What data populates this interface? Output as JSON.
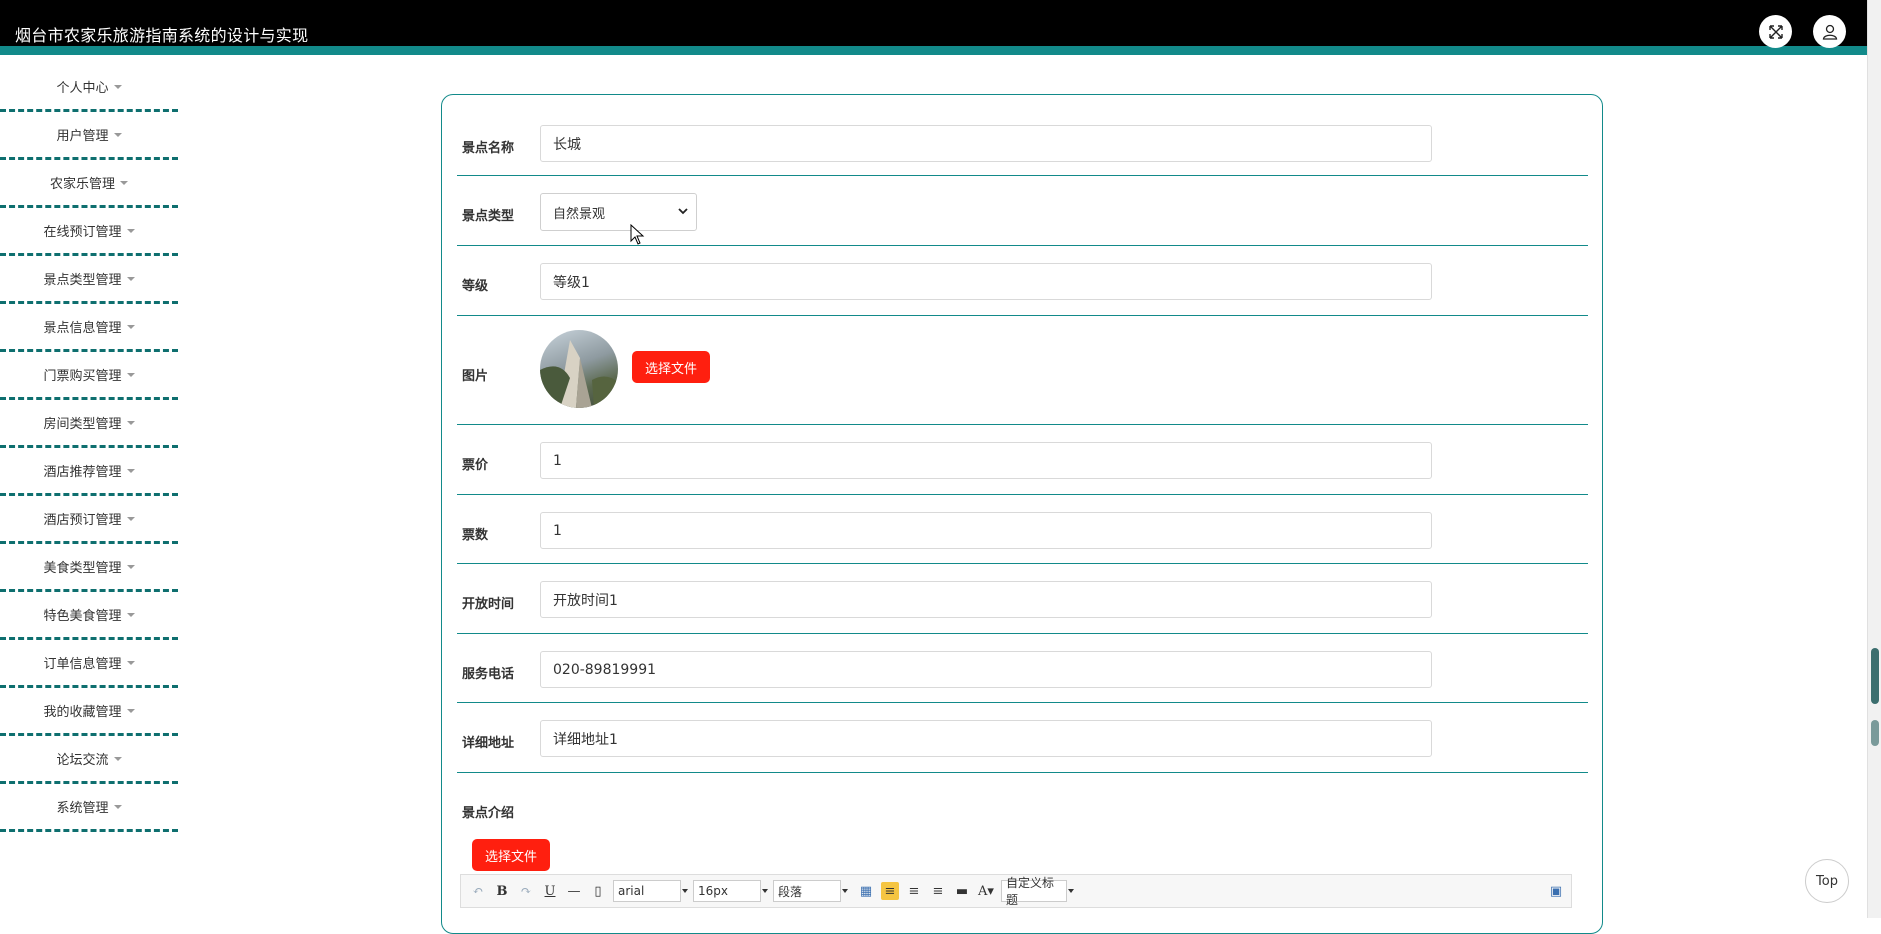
{
  "header": {
    "title": "烟台市农家乐旅游指南系统的设计与实现"
  },
  "sidebar": {
    "items": [
      {
        "label": "个人中心"
      },
      {
        "label": "用户管理"
      },
      {
        "label": "农家乐管理"
      },
      {
        "label": "在线预订管理"
      },
      {
        "label": "景点类型管理"
      },
      {
        "label": "景点信息管理"
      },
      {
        "label": "门票购买管理"
      },
      {
        "label": "房间类型管理"
      },
      {
        "label": "酒店推荐管理"
      },
      {
        "label": "酒店预订管理"
      },
      {
        "label": "美食类型管理"
      },
      {
        "label": "特色美食管理"
      },
      {
        "label": "订单信息管理"
      },
      {
        "label": "我的收藏管理"
      },
      {
        "label": "论坛交流"
      },
      {
        "label": "系统管理"
      }
    ]
  },
  "form": {
    "name_label": "景点名称",
    "name_value": "长城",
    "type_label": "景点类型",
    "type_value": "自然景观",
    "grade_label": "等级",
    "grade_value": "等级1",
    "image_label": "图片",
    "choose_file": "选择文件",
    "price_label": "票价",
    "price_value": "1",
    "count_label": "票数",
    "count_value": "1",
    "open_label": "开放时间",
    "open_value": "开放时间1",
    "phone_label": "服务电话",
    "phone_value": "020-89819991",
    "addr_label": "详细地址",
    "addr_value": "详细地址1",
    "intro_label": "景点介绍",
    "intro_choose_file": "选择文件"
  },
  "editor": {
    "font_family": "arial",
    "font_size": "16px",
    "paragraph": "段落",
    "custom_title": "自定义标题"
  },
  "top_button": "Top",
  "colors": {
    "accent": "#128a8a",
    "header_bg": "#000000",
    "button_red": "#ff1f0f"
  }
}
